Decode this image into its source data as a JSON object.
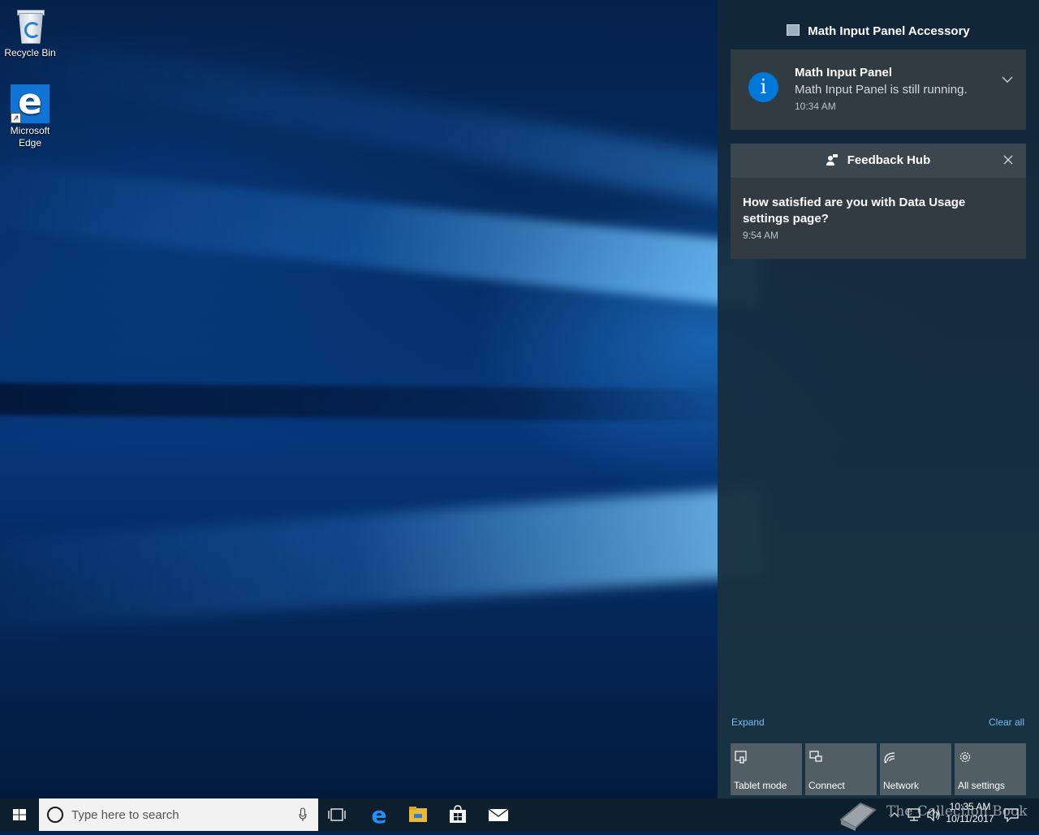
{
  "desktop": {
    "icons": [
      {
        "label": "Recycle Bin",
        "icon": "recycle-bin-icon"
      },
      {
        "label": "Microsoft Edge",
        "icon": "edge-icon"
      }
    ]
  },
  "action_center": {
    "header": {
      "title": "Math Input Panel Accessory",
      "icon": "math-input-panel-icon"
    },
    "notifications": [
      {
        "app": "Math Input Panel",
        "message": "Math Input Panel is still running.",
        "time": "10:34 AM",
        "icon": "info-icon"
      },
      {
        "app": "Feedback Hub",
        "message": "How satisfied are you with Data Usage settings page?",
        "time": "9:54 AM",
        "icon": "feedback-hub-icon"
      }
    ],
    "expand_label": "Expand",
    "clear_all_label": "Clear all",
    "quick_actions": [
      {
        "label": "Tablet mode",
        "icon": "tablet-mode-icon"
      },
      {
        "label": "Connect",
        "icon": "connect-icon"
      },
      {
        "label": "Network",
        "icon": "network-icon"
      },
      {
        "label": "All settings",
        "icon": "settings-gear-icon"
      }
    ],
    "colors": {
      "accent": "#0078d7",
      "link": "#78bdf5"
    }
  },
  "taskbar": {
    "search_placeholder": "Type here to search",
    "clock": {
      "time": "10:35 AM",
      "date": "10/11/2017"
    },
    "pinned": [
      "task-view-icon",
      "edge-icon",
      "file-explorer-icon",
      "store-icon",
      "mail-icon"
    ]
  },
  "watermark": {
    "text": "The Collection Book"
  }
}
